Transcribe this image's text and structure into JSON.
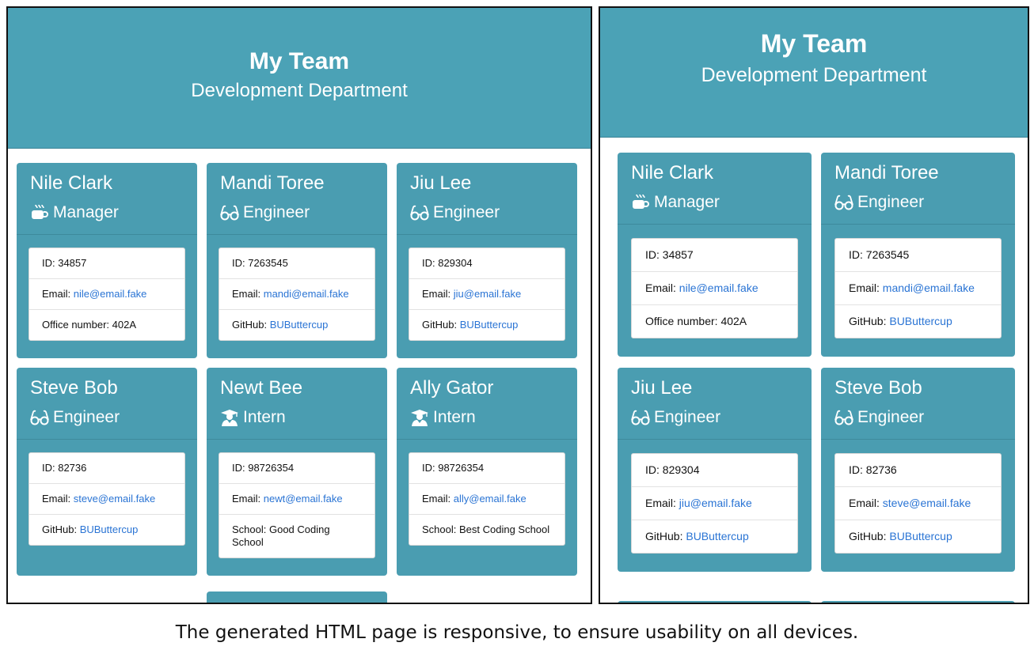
{
  "header": {
    "title": "My Team",
    "subtitle": "Development Department"
  },
  "colors": {
    "hero": "#4ba2b6",
    "card": "#4a9db1",
    "link": "#2a74d4"
  },
  "team": [
    {
      "name": "Nile Clark",
      "role": "Manager",
      "icon": "coffee-icon",
      "id_label": "ID: 34857",
      "email_label": "Email: ",
      "email": "nile@email.fake",
      "extra_label": "Office number: 402A",
      "extra_link": ""
    },
    {
      "name": "Mandi Toree",
      "role": "Engineer",
      "icon": "glasses-icon",
      "id_label": "ID: 7263545",
      "email_label": "Email: ",
      "email": "mandi@email.fake",
      "extra_label": "GitHub: ",
      "extra_link": "BUButtercup"
    },
    {
      "name": "Jiu Lee",
      "role": "Engineer",
      "icon": "glasses-icon",
      "id_label": "ID: 829304",
      "email_label": "Email: ",
      "email": "jiu@email.fake",
      "extra_label": "GitHub: ",
      "extra_link": "BUButtercup"
    },
    {
      "name": "Steve Bob",
      "role": "Engineer",
      "icon": "glasses-icon",
      "id_label": "ID: 82736",
      "email_label": "Email: ",
      "email": "steve@email.fake",
      "extra_label": "GitHub: ",
      "extra_link": "BUButtercup"
    },
    {
      "name": "Newt Bee",
      "role": "Intern",
      "icon": "graduate-icon",
      "id_label": "ID: 98726354",
      "email_label": "Email: ",
      "email": "newt@email.fake",
      "extra_label": "School: Good Coding School",
      "extra_link": ""
    },
    {
      "name": "Ally Gator",
      "role": "Intern",
      "icon": "graduate-icon",
      "id_label": "ID: 98726354",
      "email_label": "Email: ",
      "email": "ally@email.fake",
      "extra_label": "School: Best Coding School",
      "extra_link": ""
    }
  ],
  "caption": "The generated HTML page is responsive, to ensure usability on all devices."
}
